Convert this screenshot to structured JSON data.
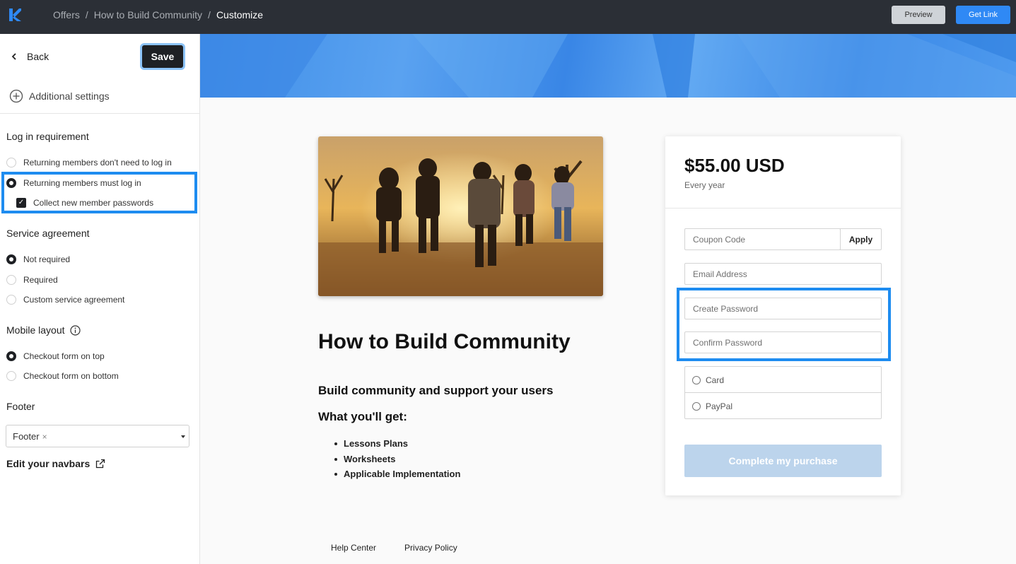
{
  "topbar": {
    "breadcrumbs": [
      "Offers",
      "How to Build Community",
      "Customize"
    ],
    "separator": "/",
    "preview_label": "Preview",
    "getlink_label": "Get Link"
  },
  "sidebar": {
    "back_label": "Back",
    "save_label": "Save",
    "additional_settings": "Additional settings",
    "login": {
      "title": "Log in requirement",
      "options": [
        "Returning members don't need to log in",
        "Returning members must log in"
      ],
      "selected": 1,
      "collect_passwords": "Collect new member passwords",
      "collect_checked": true
    },
    "service": {
      "title": "Service agreement",
      "options": [
        "Not required",
        "Required",
        "Custom service agreement"
      ],
      "selected": 0
    },
    "mobile": {
      "title": "Mobile layout",
      "options": [
        "Checkout form on top",
        "Checkout form on bottom"
      ],
      "selected": 0
    },
    "footer": {
      "title": "Footer",
      "selected_tag": "Footer",
      "remove_glyph": "×"
    },
    "edit_navbars": "Edit your navbars"
  },
  "offer": {
    "title": "How to Build Community",
    "subtitle": "Build community and support your users",
    "what_you_get": "What you'll get:",
    "items": [
      "Lessons Plans",
      "Worksheets",
      "Applicable Implementation"
    ]
  },
  "footer_links": [
    "Help Center",
    "Privacy Policy"
  ],
  "checkout": {
    "price": "$55.00 USD",
    "period": "Every year",
    "coupon_placeholder": "Coupon Code",
    "apply_label": "Apply",
    "email_placeholder": "Email Address",
    "password_placeholder": "Create Password",
    "confirm_placeholder": "Confirm Password",
    "payment_methods": [
      "Card",
      "PayPal"
    ],
    "complete_label": "Complete my purchase"
  },
  "colors": {
    "topbar": "#2b2f36",
    "accent": "#2f89f5",
    "highlight": "#1e8cf0",
    "complete_disabled": "#bcd4ec"
  }
}
